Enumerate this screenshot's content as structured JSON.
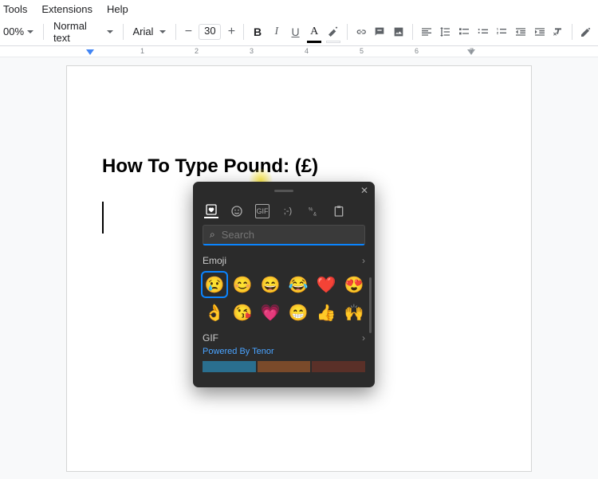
{
  "menu": {
    "tools": "Tools",
    "extensions": "Extensions",
    "help": "Help"
  },
  "toolbar": {
    "zoom": "00%",
    "style": "Normal text",
    "font": "Arial",
    "font_size": "30",
    "minus": "−",
    "plus": "+",
    "bold": "B",
    "italic": "I",
    "underline": "U",
    "text_color": "A"
  },
  "ruler": {
    "marks": [
      "1",
      "2",
      "3",
      "4",
      "5",
      "6",
      "7"
    ]
  },
  "document": {
    "heading": "How To Type Pound: (£)"
  },
  "emoji_panel": {
    "tabs": {
      "recent": "❤",
      "emoji": "☺",
      "gif": "GIF",
      "kaomoji": ";-)",
      "symbols": "%",
      "clipboard": "▭"
    },
    "search_placeholder": "Search",
    "section_emoji": "Emoji",
    "emojis_row1": [
      "😢",
      "😊",
      "😄",
      "😂",
      "❤️",
      "😍"
    ],
    "emojis_row2": [
      "👌",
      "😘",
      "💗",
      "😁",
      "👍",
      "🙌"
    ],
    "section_gif": "GIF",
    "gif_attr": "Powered By Tenor",
    "chevron": "›",
    "close": "✕",
    "search_icon": "⌕"
  }
}
